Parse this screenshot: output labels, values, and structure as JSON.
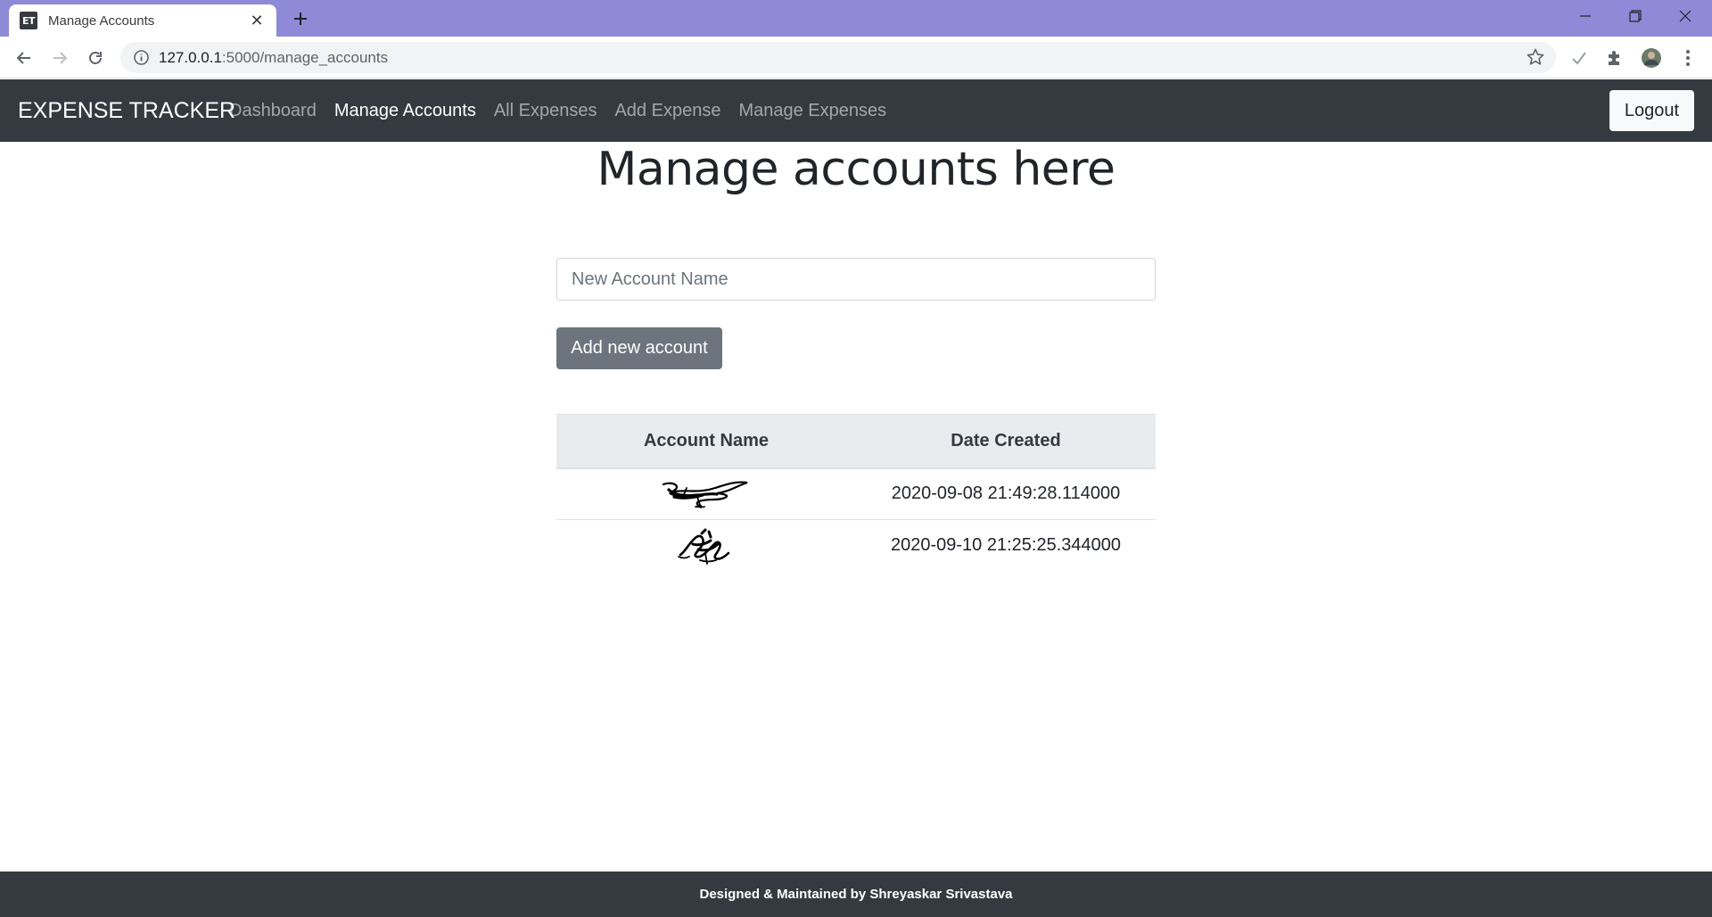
{
  "browser": {
    "tab_title": "Manage Accounts",
    "favicon_text": "ET",
    "url_host": "127.0.0.1",
    "url_path": ":5000/manage_accounts"
  },
  "navbar": {
    "brand": "EXPENSE TRACKER",
    "links": [
      {
        "label": "Dashboard",
        "active": false
      },
      {
        "label": "Manage Accounts",
        "active": true
      },
      {
        "label": "All Expenses",
        "active": false
      },
      {
        "label": "Add Expense",
        "active": false
      },
      {
        "label": "Manage Expenses",
        "active": false
      }
    ],
    "logout_label": "Logout"
  },
  "main": {
    "title": "Manage accounts here",
    "input_placeholder": "New Account Name",
    "input_value": "",
    "add_button_label": "Add new account"
  },
  "table": {
    "headers": [
      "Account Name",
      "Date Created"
    ],
    "rows": [
      {
        "account_name_icon": "scribbled-signature-icon",
        "date_created": "2020-09-08 21:49:28.114000"
      },
      {
        "account_name_icon": "scribbled-signature-icon",
        "date_created": "2020-09-10 21:25:25.344000"
      }
    ]
  },
  "footer": {
    "prefix": "Designed & Maintained by ",
    "author": "Shreyaskar Srivastava"
  },
  "colors": {
    "tabbar": "#8e8ad8",
    "navbar": "#343a40",
    "button_secondary": "#6c757d",
    "table_header": "#e9ecef"
  }
}
